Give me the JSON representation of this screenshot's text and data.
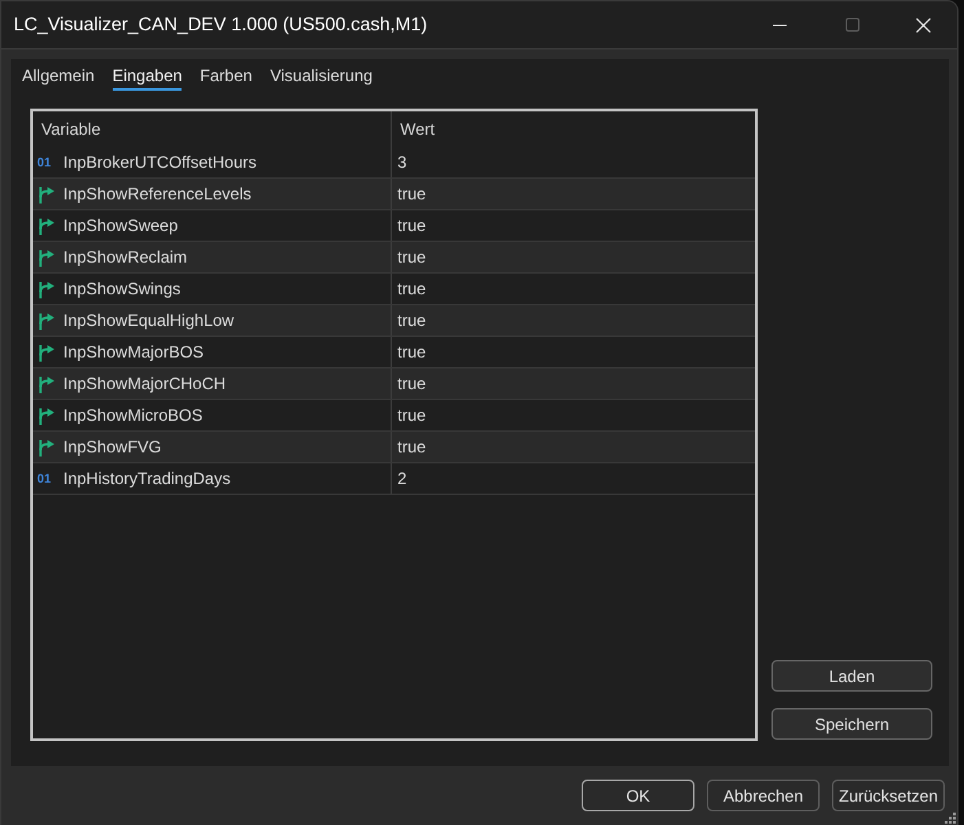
{
  "window": {
    "title": "LC_Visualizer_CAN_DEV 1.000 (US500.cash,M1)",
    "controls": [
      {
        "kind": "minimize",
        "disabled": false
      },
      {
        "kind": "maximize",
        "disabled": true
      },
      {
        "kind": "close",
        "disabled": false
      }
    ]
  },
  "tabs": [
    {
      "label": "Allgemein",
      "selected": false
    },
    {
      "label": "Eingaben",
      "selected": true
    },
    {
      "label": "Farben",
      "selected": false
    },
    {
      "label": "Visualisierung",
      "selected": false
    }
  ],
  "table": {
    "columns": [
      "Variable",
      "Wert"
    ],
    "rows": [
      {
        "kind": "int",
        "type_mark": "01",
        "variable": "InpBrokerUTCOffsetHours",
        "value": "3"
      },
      {
        "kind": "bool",
        "variable": "InpShowReferenceLevels",
        "value": "true"
      },
      {
        "kind": "bool",
        "variable": "InpShowSweep",
        "value": "true"
      },
      {
        "kind": "bool",
        "variable": "InpShowReclaim",
        "value": "true"
      },
      {
        "kind": "bool",
        "variable": "InpShowSwings",
        "value": "true"
      },
      {
        "kind": "bool",
        "variable": "InpShowEqualHighLow",
        "value": "true"
      },
      {
        "kind": "bool",
        "variable": "InpShowMajorBOS",
        "value": "true"
      },
      {
        "kind": "bool",
        "variable": "InpShowMajorCHoCH",
        "value": "true"
      },
      {
        "kind": "bool",
        "variable": "InpShowMicroBOS",
        "value": "true"
      },
      {
        "kind": "bool",
        "variable": "InpShowFVG",
        "value": "true"
      },
      {
        "kind": "int",
        "type_mark": "01",
        "variable": "InpHistoryTradingDays",
        "value": "2"
      }
    ]
  },
  "side_buttons": [
    "Laden",
    "Speichern"
  ],
  "buttons": [
    {
      "label": "OK",
      "default": true
    },
    {
      "label": "Abbrechen",
      "default": false
    },
    {
      "label": "Zurücksetzen",
      "default": false
    }
  ]
}
